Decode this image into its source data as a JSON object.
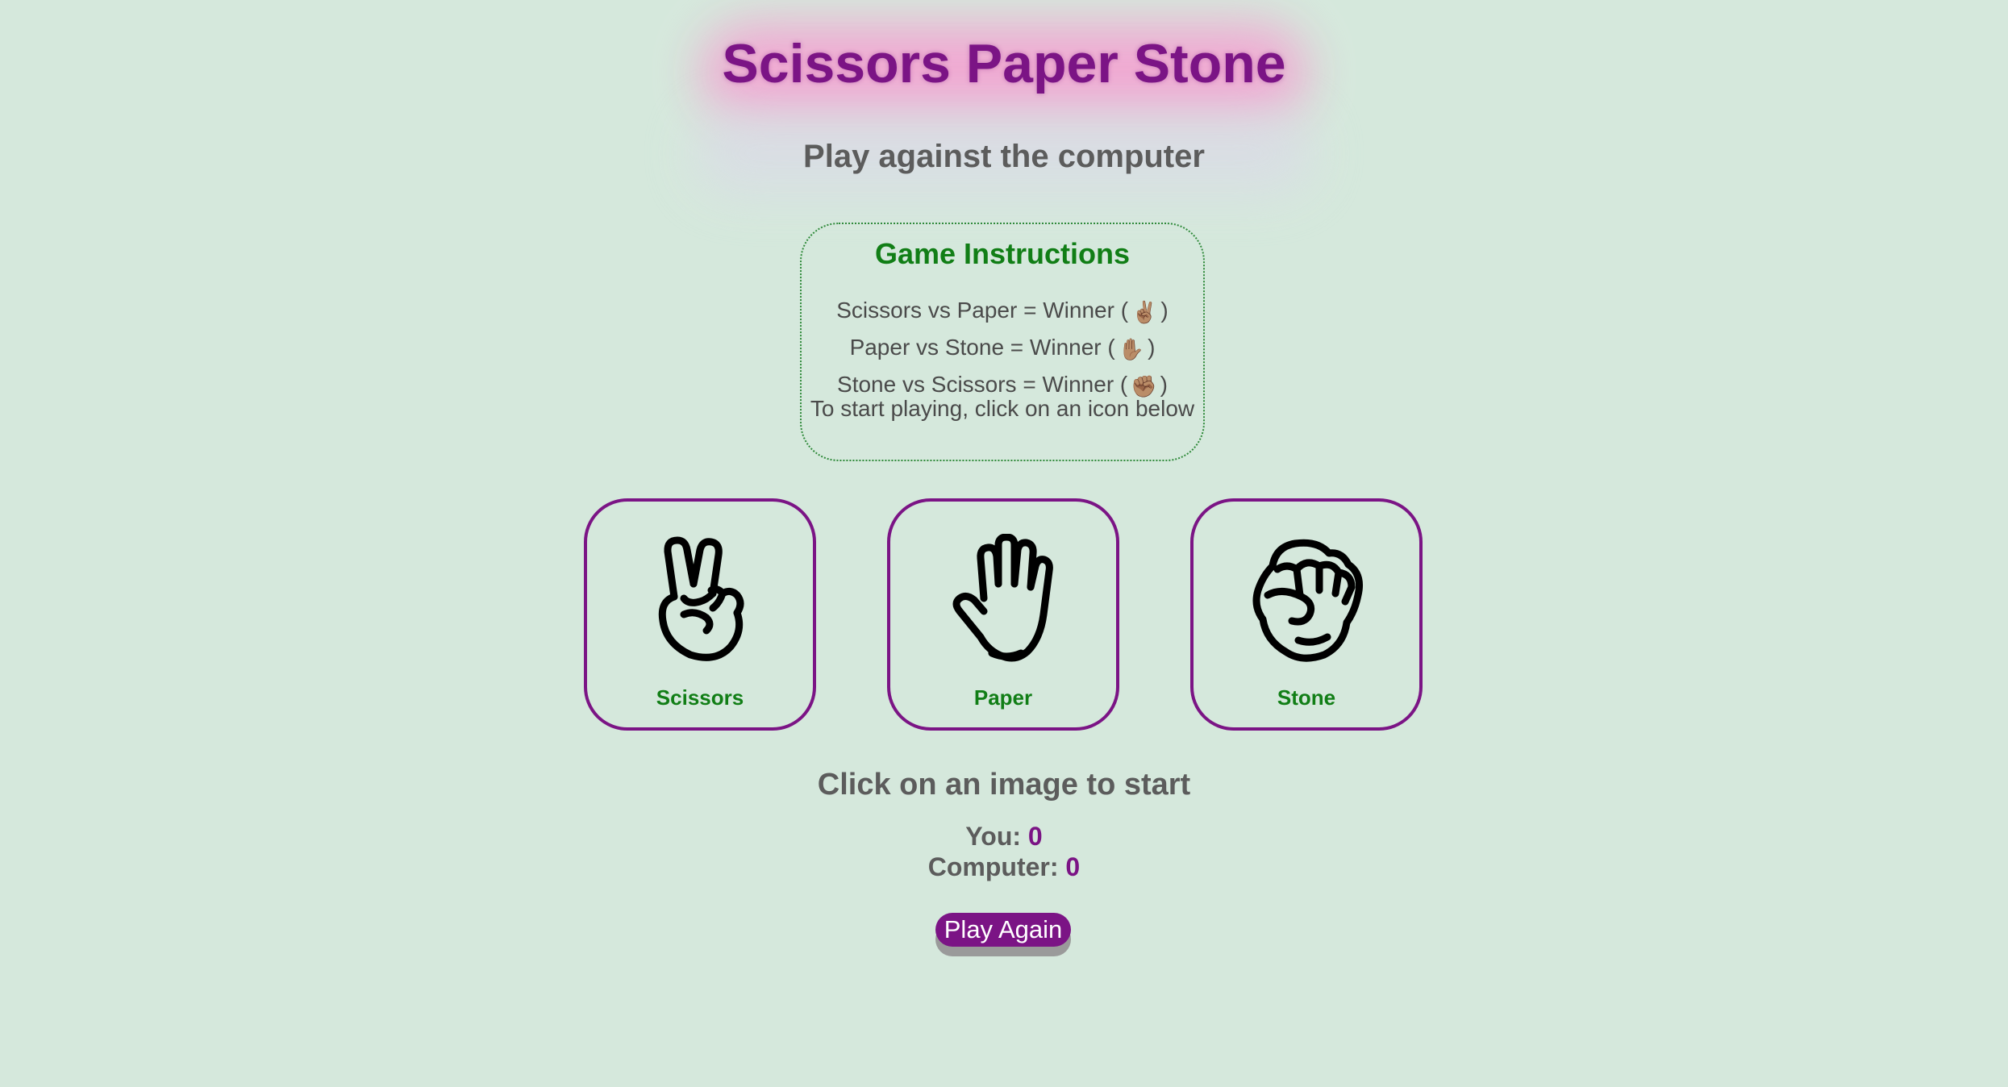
{
  "header": {
    "title": "Scissors Paper Stone",
    "subtitle": "Play against the computer"
  },
  "instructions": {
    "title": "Game Instructions",
    "rules": [
      {
        "text": "Scissors vs Paper = Winner (",
        "emoji": "✌🏽",
        "close": ")"
      },
      {
        "text": "Paper vs Stone = Winner (",
        "emoji": "✋🏽",
        "close": ")"
      },
      {
        "text": "Stone vs Scissors = Winner (",
        "emoji": "✊🏽",
        "close": ")"
      }
    ],
    "start_hint": "To start playing, click on an icon below"
  },
  "choices": [
    {
      "label": "Scissors",
      "icon": "scissors-hand-icon"
    },
    {
      "label": "Paper",
      "icon": "paper-hand-icon"
    },
    {
      "label": "Stone",
      "icon": "stone-fist-icon"
    }
  ],
  "status": "Click on an image to start",
  "scores": {
    "you_label": "You:",
    "you_value": "0",
    "computer_label": "Computer:",
    "computer_value": "0"
  },
  "play_again_label": "Play Again",
  "colors": {
    "background": "#d5e8dc",
    "accent": "#7b1485",
    "green": "#117e16",
    "text_gray": "#5c5c5c"
  }
}
